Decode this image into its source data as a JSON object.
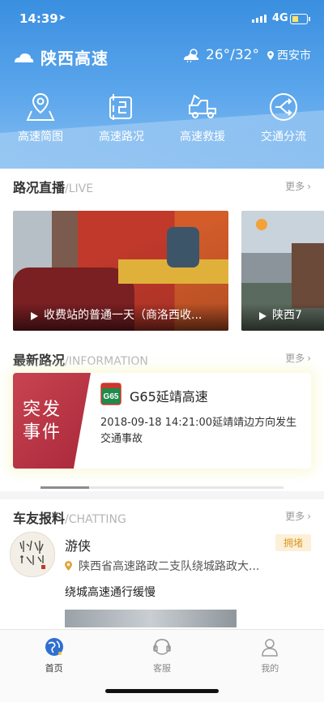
{
  "status_bar": {
    "time": "14:39",
    "network": "4G"
  },
  "header": {
    "app_title": "陕西高速",
    "weather": {
      "temperature": "26°/32°",
      "city": "西安市"
    },
    "shortcuts": [
      {
        "label": "高速简图",
        "icon": "map-pin-icon"
      },
      {
        "label": "高速路况",
        "icon": "road-icon"
      },
      {
        "label": "高速救援",
        "icon": "tow-truck-icon"
      },
      {
        "label": "交通分流",
        "icon": "diversion-icon"
      }
    ]
  },
  "live": {
    "title": "路况直播",
    "title_en": "/LIVE",
    "more": "更多",
    "videos": [
      {
        "caption": "收费站的普通一天（商洛西收..."
      },
      {
        "caption": "陕西7"
      }
    ]
  },
  "information": {
    "title": "最新路况",
    "title_en": "/INFORMATION",
    "more": "更多",
    "card": {
      "badge": [
        "突发",
        "事件"
      ],
      "shield_code": "G65",
      "road": "G65延靖高速",
      "description": "2018-09-18 14:21:00延靖靖边方向发生交通事故"
    },
    "scroll_position": 0.2
  },
  "chatting": {
    "title": "车友报料",
    "title_en": "/CHATTING",
    "more": "更多",
    "post": {
      "user": "游侠",
      "tag": "拥堵",
      "location": "陕西省高速路政二支队绕城路政大...",
      "text": "绕城高速通行缓慢"
    }
  },
  "tabbar": {
    "items": [
      {
        "label": "首页",
        "icon": "globe-icon",
        "active": true
      },
      {
        "label": "客服",
        "icon": "headset-icon",
        "active": false
      },
      {
        "label": "我的",
        "icon": "person-icon",
        "active": false
      }
    ]
  },
  "colors": {
    "header_blue": "#3a8fe0",
    "badge_red": "#b8323f",
    "tag_orange": "#d99a2a"
  }
}
